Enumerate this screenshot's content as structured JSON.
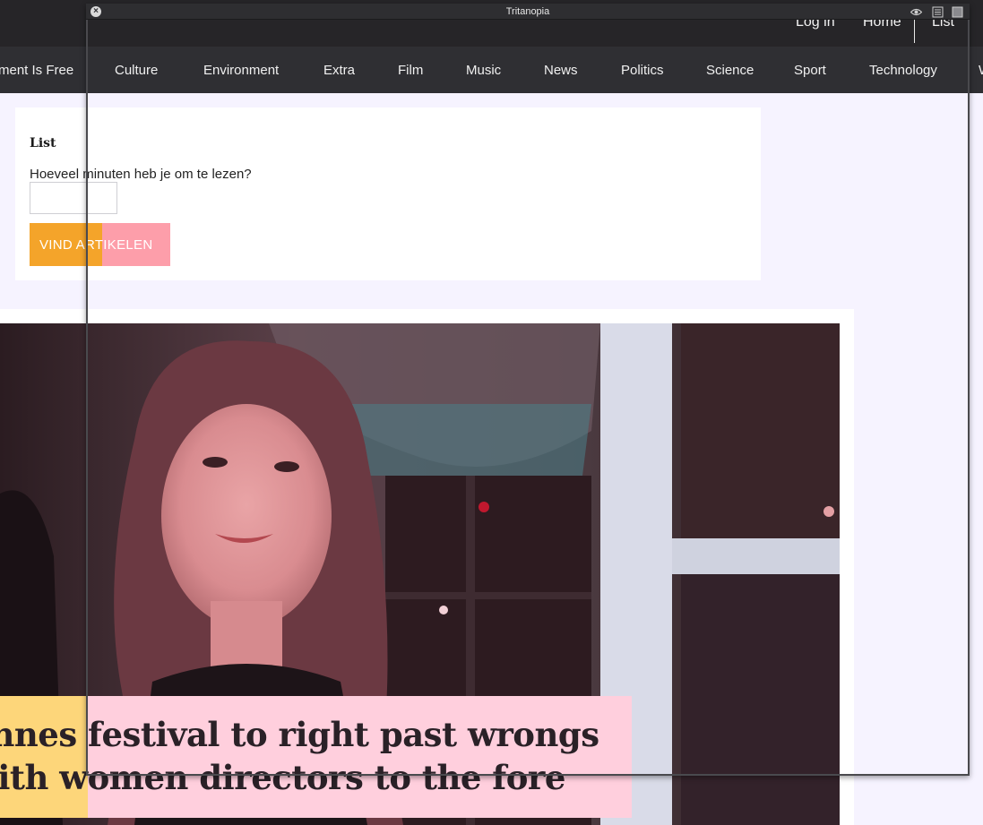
{
  "user_bar": {
    "login": "Log in",
    "home": "Home",
    "list": "List"
  },
  "nav": {
    "items": [
      "ment Is Free",
      "Culture",
      "Environment",
      "Extra",
      "Film",
      "Music",
      "News",
      "Politics",
      "Science",
      "Sport",
      "Technology",
      "W"
    ]
  },
  "list_card": {
    "title": "List",
    "question": "Hoeveel minuten heb je om te lezen?",
    "input_value": "",
    "button_label": "VIND ARTIKELEN"
  },
  "article": {
    "headline": "annes festival to right past wrongs\nwith women directors to the fore"
  },
  "overlay": {
    "title": "Tritanopia",
    "close_glyph": "×"
  },
  "colors": {
    "topbar": "#262528",
    "nav": "#2f2f33",
    "page_bg": "#f6f3ff",
    "button_orange": "#f4a42a",
    "button_pink": "#fd9eaa",
    "headline_yellow": "#fdd67a",
    "headline_pink": "#ffcfdd"
  }
}
